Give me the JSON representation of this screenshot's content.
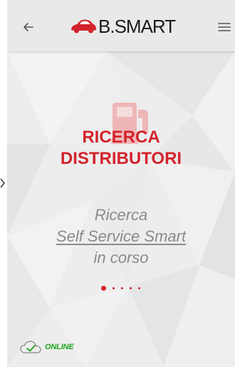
{
  "header": {
    "back_icon": "arrow-left-icon",
    "logo_text": "B.SMART",
    "menu_icon": "hamburger-menu-icon"
  },
  "main": {
    "illustration_icon": "fuel-pump-icon",
    "title_line1": "RICERCA",
    "title_line2": "DISTRIBUTORI",
    "status_line1": "Ricerca",
    "status_line2": "Self Service Smart",
    "status_line3": "in corso",
    "progress_dots": 5,
    "progress_active": 1
  },
  "footer": {
    "connection_icon": "cloud-check-icon",
    "connection_label": "ONLINE"
  },
  "colors": {
    "accent": "#d4232c",
    "online": "#1aa51a",
    "header_bg": "#e9e9e9",
    "text_muted": "#8a8a8a"
  }
}
